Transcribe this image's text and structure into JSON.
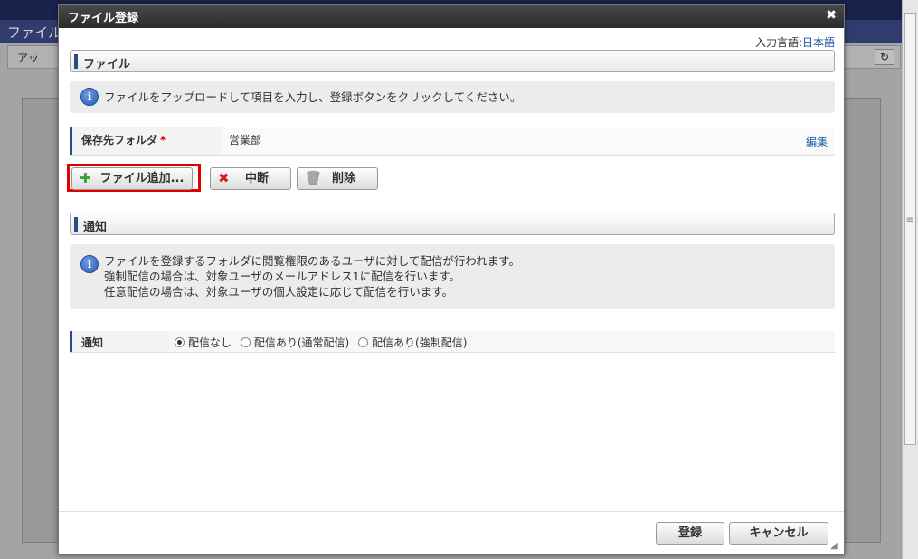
{
  "background": {
    "window_title": "ファイル",
    "toolbar_item": "アッ",
    "refresh_icon": "refresh-icon"
  },
  "dialog": {
    "title": "ファイル登録",
    "close_icon": "close-icon"
  },
  "language": {
    "label": "入力言語:",
    "value": "日本語"
  },
  "file_section": {
    "title": "ファイル",
    "info": "ファイルをアップロードして項目を入力し、登録ボタンをクリックしてください。"
  },
  "folder_field": {
    "label": "保存先フォルダ",
    "required": "*",
    "value": "営業部",
    "edit_label": "編集"
  },
  "file_buttons": {
    "add": "ファイル追加...",
    "stop": "中断",
    "delete": "削除"
  },
  "notify_section": {
    "title": "通知",
    "info_lines": [
      "ファイルを登録するフォルダに閲覧権限のあるユーザに対して配信が行われます。",
      "強制配信の場合は、対象ユーザのメールアドレス1に配信を行います。",
      "任意配信の場合は、対象ユーザの個人設定に応じて配信を行います。"
    ]
  },
  "notify_field": {
    "label": "通知",
    "options": [
      {
        "label": "配信なし",
        "selected": true
      },
      {
        "label": "配信あり(通常配信)",
        "selected": false
      },
      {
        "label": "配信あり(強制配信)",
        "selected": false
      }
    ]
  },
  "footer": {
    "register": "登録",
    "cancel": "キャンセル"
  },
  "colors": {
    "accent": "#2a4a8a",
    "highlight": "#e00000",
    "link": "#1a55a8"
  }
}
